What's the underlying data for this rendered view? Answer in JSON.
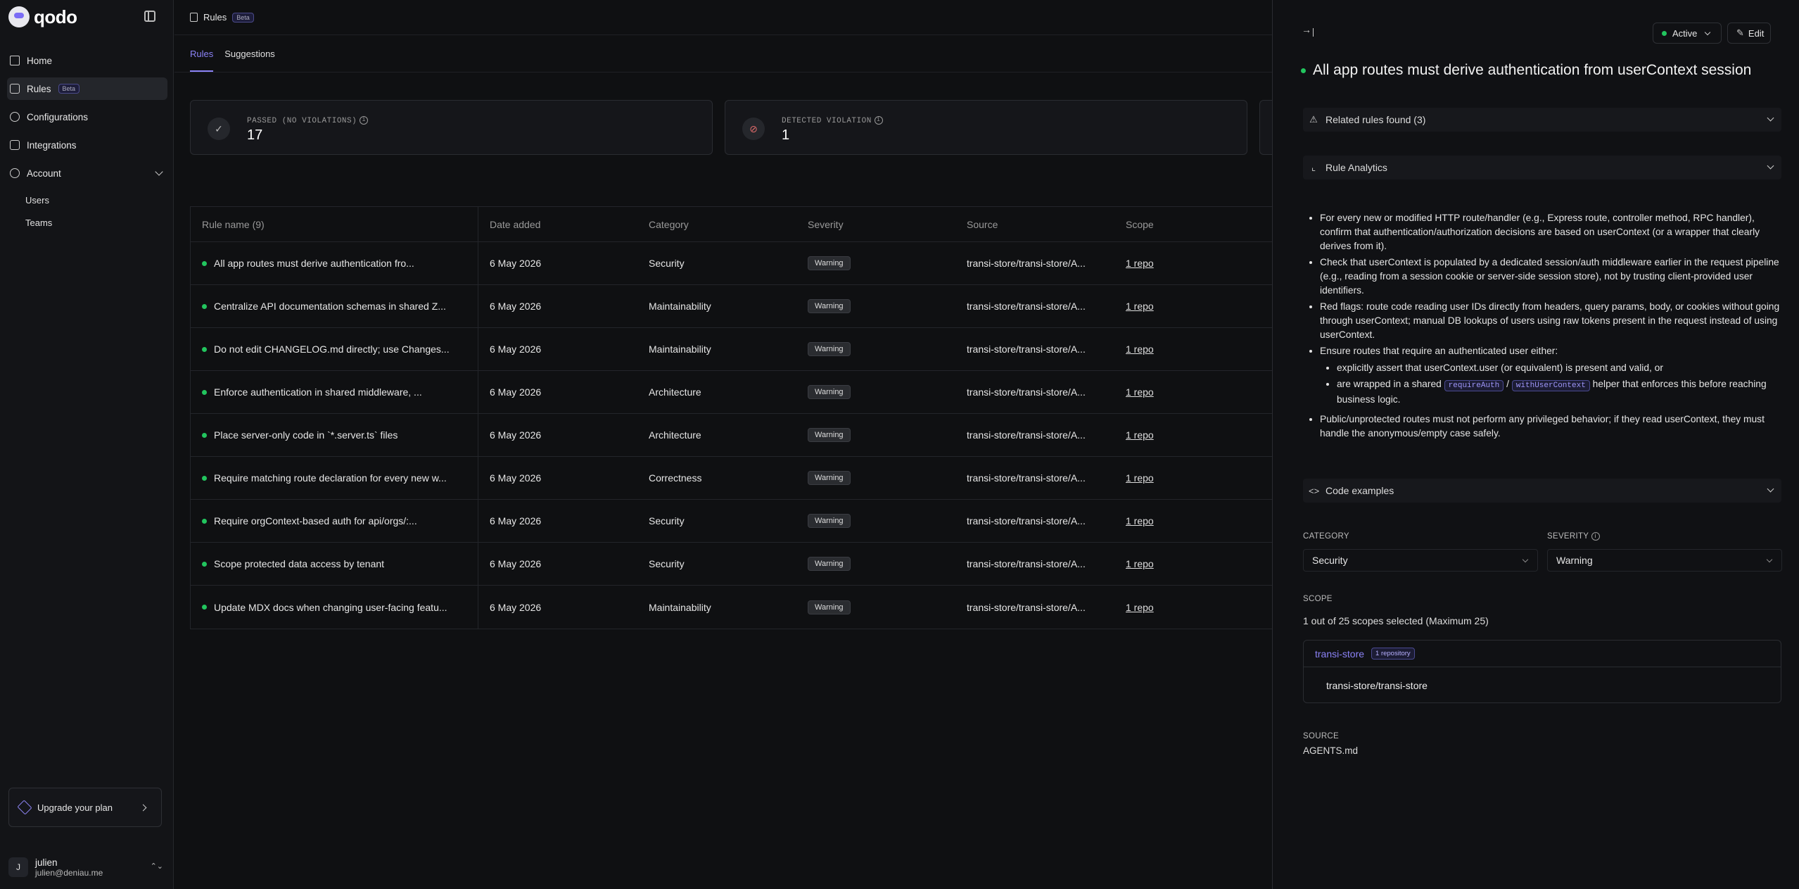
{
  "brand": {
    "name": "qodo"
  },
  "nav": {
    "home": "Home",
    "rules": "Rules",
    "rules_badge": "Beta",
    "configurations": "Configurations",
    "integrations": "Integrations",
    "account": "Account",
    "users": "Users",
    "teams": "Teams"
  },
  "upgrade": {
    "label": "Upgrade your plan"
  },
  "user": {
    "initial": "J",
    "name": "julien",
    "email": "julien@deniau.me"
  },
  "topbar": {
    "title": "Rules",
    "badge": "Beta"
  },
  "tabs": {
    "rules": "Rules",
    "suggestions": "Suggestions"
  },
  "stats": {
    "passed_label": "PASSED (NO VIOLATIONS)",
    "passed_value": "17",
    "violation_label": "DETECTED VIOLATION",
    "violation_value": "1"
  },
  "table": {
    "headers": {
      "name": "Rule name (9)",
      "date": "Date added",
      "category": "Category",
      "severity": "Severity",
      "source": "Source",
      "scope": "Scope"
    },
    "rows": [
      {
        "name": "All app routes must derive authentication fro...",
        "date": "6 May 2026",
        "category": "Security",
        "severity": "Warning",
        "source": "transi-store/transi-store/A...",
        "scope": "1 repo"
      },
      {
        "name": "Centralize API documentation schemas in shared Z...",
        "date": "6 May 2026",
        "category": "Maintainability",
        "severity": "Warning",
        "source": "transi-store/transi-store/A...",
        "scope": "1 repo"
      },
      {
        "name": "Do not edit CHANGELOG.md directly; use Changes...",
        "date": "6 May 2026",
        "category": "Maintainability",
        "severity": "Warning",
        "source": "transi-store/transi-store/A...",
        "scope": "1 repo"
      },
      {
        "name": "Enforce authentication in shared middleware, ...",
        "date": "6 May 2026",
        "category": "Architecture",
        "severity": "Warning",
        "source": "transi-store/transi-store/A...",
        "scope": "1 repo"
      },
      {
        "name": "Place server-only code in `*.server.ts` files",
        "date": "6 May 2026",
        "category": "Architecture",
        "severity": "Warning",
        "source": "transi-store/transi-store/A...",
        "scope": "1 repo"
      },
      {
        "name": "Require matching route declaration for every new w...",
        "date": "6 May 2026",
        "category": "Correctness",
        "severity": "Warning",
        "source": "transi-store/transi-store/A...",
        "scope": "1 repo"
      },
      {
        "name": "Require orgContext-based auth for api/orgs/:...",
        "date": "6 May 2026",
        "category": "Security",
        "severity": "Warning",
        "source": "transi-store/transi-store/A...",
        "scope": "1 repo"
      },
      {
        "name": "Scope protected data access by tenant",
        "date": "6 May 2026",
        "category": "Security",
        "severity": "Warning",
        "source": "transi-store/transi-store/A...",
        "scope": "1 repo"
      },
      {
        "name": "Update MDX docs when changing user-facing featu...",
        "date": "6 May 2026",
        "category": "Maintainability",
        "severity": "Warning",
        "source": "transi-store/transi-store/A...",
        "scope": "1 repo"
      }
    ]
  },
  "panel": {
    "status": "Active",
    "edit": "Edit",
    "title": "All app routes must derive authentication from userContext session",
    "related": "Related rules found (3)",
    "analytics": "Rule Analytics",
    "bullets": {
      "b1": "For every new or modified HTTP route/handler (e.g., Express route, controller method, RPC handler), confirm that authentication/authorization decisions are based on userContext (or a wrapper that clearly derives from it).",
      "b2": "Check that userContext is populated by a dedicated session/auth middleware earlier in the request pipeline (e.g., reading from a session cookie or server-side session store), not by trusting client-provided user identifiers.",
      "b3": "Red flags: route code reading user IDs directly from headers, query params, body, or cookies without going through userContext; manual DB lookups of users using raw tokens present in the request instead of using userContext.",
      "b4": "Ensure routes that require an authenticated user either:",
      "b4a": "explicitly assert that userContext.user (or equivalent) is present and valid, or",
      "b4b_pre": "are wrapped in a shared",
      "b4b_code1": "requireAuth",
      "b4b_sep": "/",
      "b4b_code2": "withUserContext",
      "b4b_post": "helper that enforces this before reaching business logic.",
      "b5": "Public/unprotected routes must not perform any privileged behavior; if they read userContext, they must handle the anonymous/empty case safely."
    },
    "code_examples": "Code examples",
    "category_label": "CATEGORY",
    "category_value": "Security",
    "severity_label": "SEVERITY",
    "severity_value": "Warning",
    "scope_label": "SCOPE",
    "scope_summary": "1 out of 25 scopes selected (Maximum 25)",
    "scope_name": "transi-store",
    "scope_badge": "1 repository",
    "scope_repo": "transi-store/transi-store",
    "source_label": "SOURCE",
    "source_value": "AGENTS.md"
  }
}
